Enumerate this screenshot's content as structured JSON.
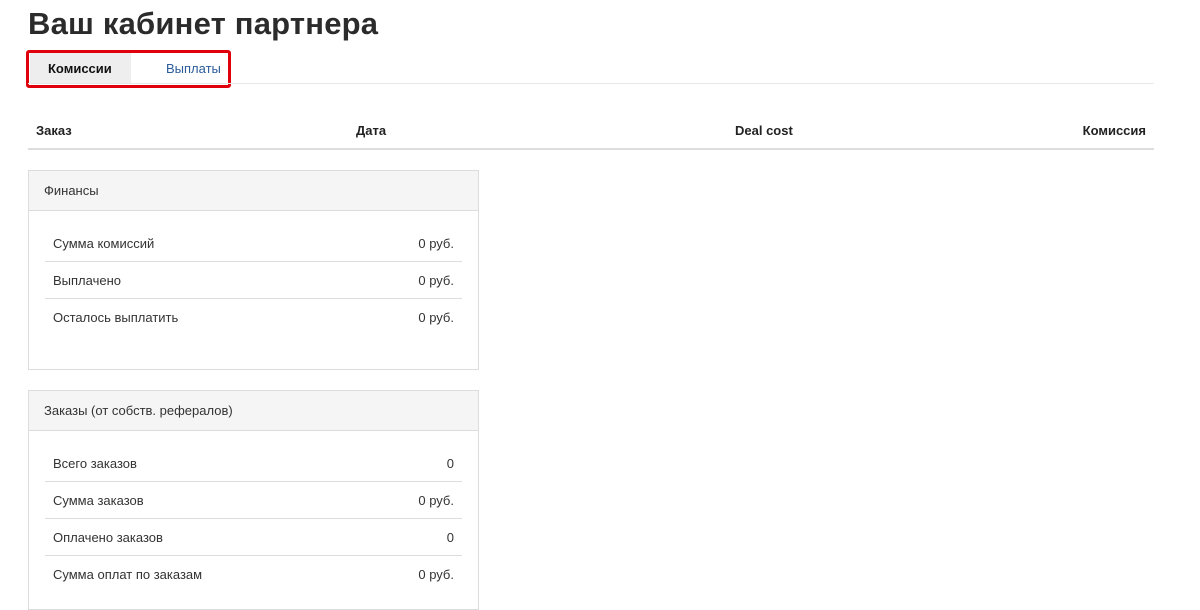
{
  "page": {
    "title": "Ваш кабинет партнера"
  },
  "tabs": [
    {
      "label": "Комиссии",
      "active": true
    },
    {
      "label": "Выплаты",
      "active": false
    }
  ],
  "commissions_table": {
    "headers": {
      "order": "Заказ",
      "date": "Дата",
      "deal_cost": "Deal cost",
      "commission": "Комиссия"
    }
  },
  "finance": {
    "title": "Финансы",
    "rows": [
      {
        "label": "Сумма комиссий",
        "value": "0 руб."
      },
      {
        "label": "Выплачено",
        "value": "0 руб."
      },
      {
        "label": "Осталось выплатить",
        "value": "0 руб."
      }
    ]
  },
  "orders": {
    "title": "Заказы (от собств. рефералов)",
    "rows": [
      {
        "label": "Всего заказов",
        "value": "0"
      },
      {
        "label": "Сумма заказов",
        "value": "0 руб."
      },
      {
        "label": "Оплачено заказов",
        "value": "0"
      },
      {
        "label": "Сумма оплат по заказам",
        "value": "0 руб."
      }
    ]
  },
  "colors": {
    "highlight": "#e0000b",
    "link": "#2a5c9a",
    "panel_heading_bg": "#f5f5f5"
  }
}
